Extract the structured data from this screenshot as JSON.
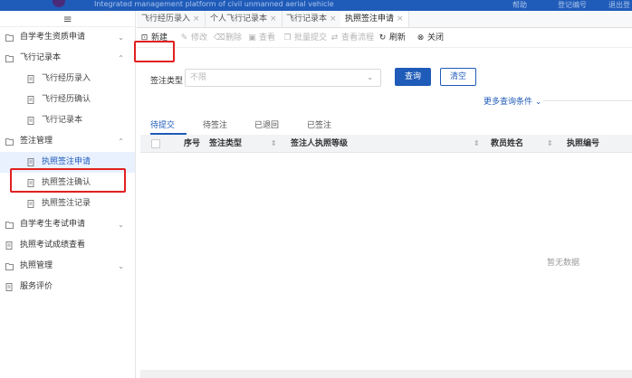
{
  "header": {
    "system_name": "Integrated management platform of civil unmanned aerial vehicle",
    "right_1": "帮助",
    "right_2": "登记编号",
    "right_3": "退出登录"
  },
  "sidebar": {
    "menu_icon": "hamburger-icon",
    "items": [
      {
        "label": "自学考生资质申请",
        "arrow": "⌄"
      },
      {
        "label": "飞行记录本",
        "arrow": "⌃"
      },
      {
        "label": "飞行经历录入"
      },
      {
        "label": "飞行经历确认"
      },
      {
        "label": "飞行记录本"
      },
      {
        "label": "签注管理",
        "arrow": "⌃"
      },
      {
        "label": "执照签注申请"
      },
      {
        "label": "执照签注确认"
      },
      {
        "label": "执照签注记录"
      },
      {
        "label": "自学考生考试申请",
        "arrow": "⌄"
      },
      {
        "label": "执照考试成绩查看"
      },
      {
        "label": "执照管理",
        "arrow": "⌄"
      },
      {
        "label": "服务评价"
      }
    ]
  },
  "tabs": [
    {
      "label": "飞行经历录入",
      "close": "×"
    },
    {
      "label": "个人飞行记录本",
      "close": "×"
    },
    {
      "label": "飞行记录本",
      "close": "×"
    },
    {
      "label": "执照签注申请",
      "close": "×"
    }
  ],
  "toolbar": {
    "new": "新建",
    "edit": "修改",
    "delete": "删除",
    "view": "查看",
    "batch_submit": "批量提交",
    "view_process": "查看流程",
    "refresh": "刷新",
    "close": "关闭"
  },
  "filter": {
    "label": "签注类型",
    "value": "不限",
    "query_button": "查询",
    "clear_button": "清空",
    "more": "更多查询条件 ⌄"
  },
  "subtabs": [
    "待提交",
    "待签注",
    "已退回",
    "已签注"
  ],
  "table": {
    "columns": [
      "序号",
      "签注类型",
      "签注人执照等级",
      "教员姓名",
      "执照编号"
    ],
    "rows": [],
    "empty_text": "暂无数据"
  },
  "colors": {
    "accent": "#1f5bb8",
    "highlight": "#e02020"
  }
}
